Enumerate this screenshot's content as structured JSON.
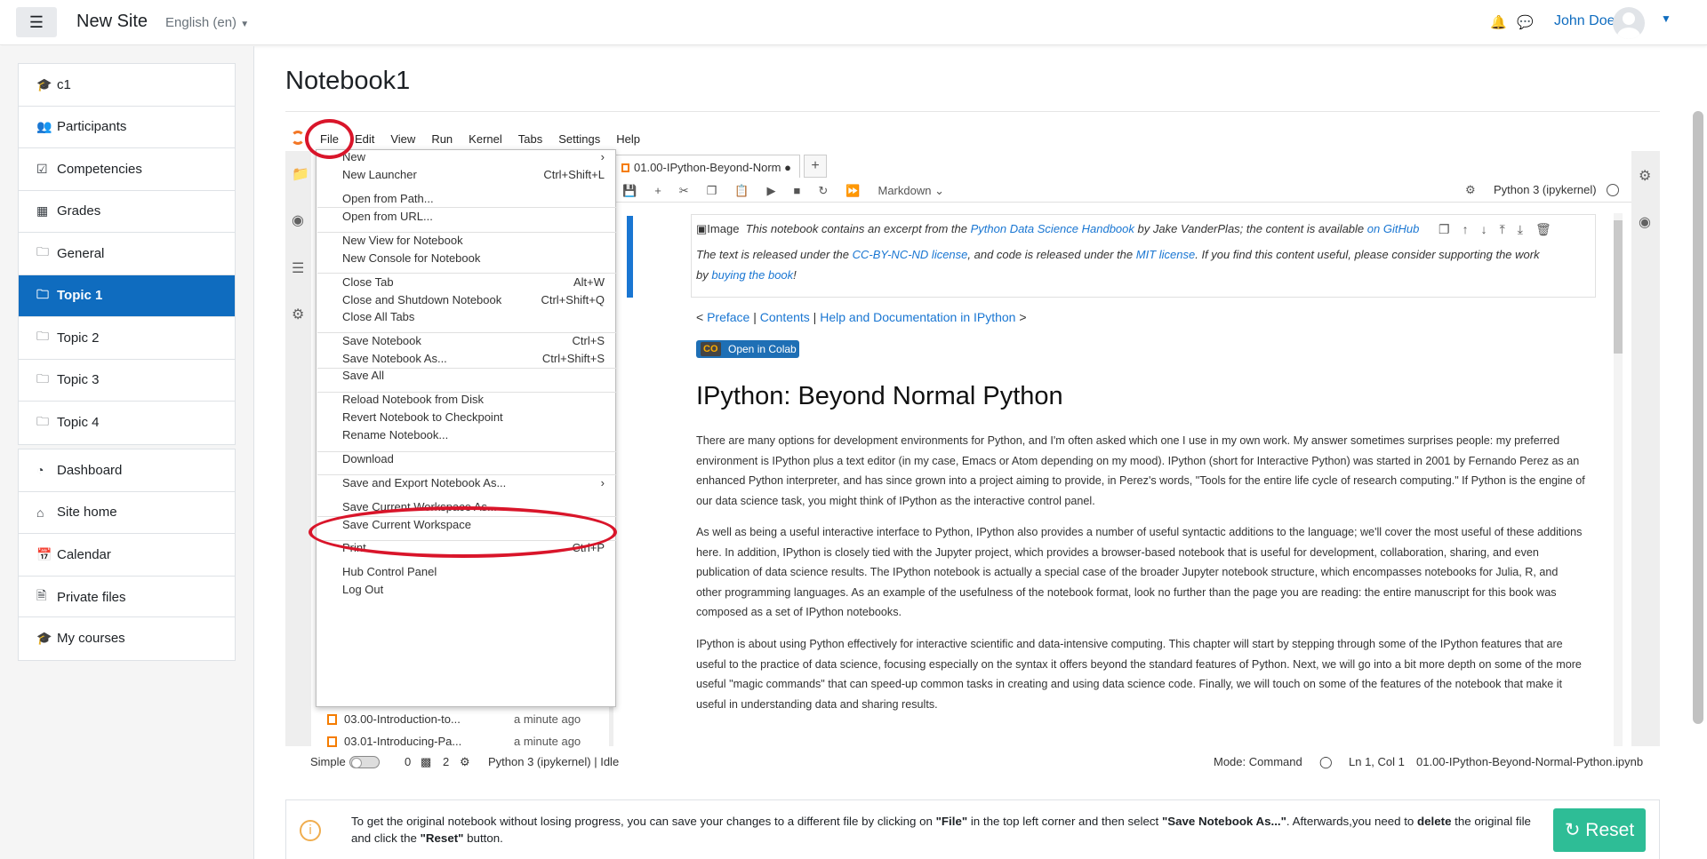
{
  "header": {
    "site_name": "New Site",
    "language": "English (en)",
    "user_name": "John Doe"
  },
  "nav": {
    "group1": [
      {
        "label": "c1",
        "icon": "graduation-cap-icon"
      },
      {
        "label": "Participants",
        "icon": "users-icon"
      },
      {
        "label": "Competencies",
        "icon": "check-square-icon"
      },
      {
        "label": "Grades",
        "icon": "table-icon"
      },
      {
        "label": "General",
        "icon": "folder-icon"
      },
      {
        "label": "Topic 1",
        "icon": "folder-icon",
        "active": true
      },
      {
        "label": "Topic 2",
        "icon": "folder-icon"
      },
      {
        "label": "Topic 3",
        "icon": "folder-icon"
      },
      {
        "label": "Topic 4",
        "icon": "folder-icon"
      }
    ],
    "group2": [
      {
        "label": "Dashboard",
        "icon": "dashboard-icon"
      },
      {
        "label": "Site home",
        "icon": "home-icon"
      },
      {
        "label": "Calendar",
        "icon": "calendar-icon"
      },
      {
        "label": "Private files",
        "icon": "file-icon"
      }
    ],
    "group3": [
      {
        "label": "My courses",
        "icon": "graduation-cap-icon"
      }
    ]
  },
  "page": {
    "title": "Notebook1"
  },
  "jupyter": {
    "menus": [
      "File",
      "Edit",
      "View",
      "Run",
      "Kernel",
      "Tabs",
      "Settings",
      "Help"
    ],
    "tab_title": "01.00-IPython-Beyond-Norm",
    "cell_type": "Markdown",
    "kernel": "Python 3 (ipykernel)",
    "files": [
      {
        "name": "03.00-Introduction-to...",
        "time": "a minute ago"
      },
      {
        "name": "03.01-Introducing-Pa...",
        "time": "a minute ago"
      }
    ],
    "file_menu": [
      {
        "label": "New",
        "shortcut": "",
        "submenu": true
      },
      {
        "label": "New Launcher",
        "shortcut": "Ctrl+Shift+L"
      },
      {
        "label": "Open from Path...",
        "shortcut": ""
      },
      {
        "label": "Open from URL...",
        "shortcut": ""
      },
      {
        "label": "New View for Notebook",
        "shortcut": ""
      },
      {
        "label": "New Console for Notebook",
        "shortcut": ""
      },
      {
        "label": "Close Tab",
        "shortcut": "Alt+W"
      },
      {
        "label": "Close and Shutdown Notebook",
        "shortcut": "Ctrl+Shift+Q"
      },
      {
        "label": "Close All Tabs",
        "shortcut": ""
      },
      {
        "label": "Save Notebook",
        "shortcut": "Ctrl+S"
      },
      {
        "label": "Save Notebook As...",
        "shortcut": "Ctrl+Shift+S"
      },
      {
        "label": "Save All",
        "shortcut": ""
      },
      {
        "label": "Reload Notebook from Disk",
        "shortcut": ""
      },
      {
        "label": "Revert Notebook to Checkpoint",
        "shortcut": ""
      },
      {
        "label": "Rename Notebook...",
        "shortcut": ""
      },
      {
        "label": "Download",
        "shortcut": ""
      },
      {
        "label": "Save and Export Notebook As...",
        "shortcut": "",
        "submenu": true
      },
      {
        "label": "Save Current Workspace As...",
        "shortcut": ""
      },
      {
        "label": "Save Current Workspace",
        "shortcut": ""
      },
      {
        "label": "Print...",
        "shortcut": "Ctrl+P"
      },
      {
        "label": "Hub Control Panel",
        "shortcut": ""
      },
      {
        "label": "Log Out",
        "shortcut": ""
      }
    ],
    "notebook": {
      "cell1_line1_a": "This notebook contains an excerpt from the",
      "cell1_link1": "Python Data Science Handbook",
      "cell1_line1_b": "by Jake VanderPlas; the content is available",
      "cell1_link2": "on GitHub",
      "cell1_line2_a": "The text is released under the",
      "cell1_link3": "CC-BY-NC-ND license",
      "cell1_line2_b": ", and code is released under the",
      "cell1_link4": "MIT license",
      "cell1_line2_c": ". If you find this content useful, please consider supporting the work",
      "cell1_line3_a": "by",
      "cell1_link5": "buying the book",
      "image_alt": "Image",
      "nav_prev": "<",
      "nav_preface": "Preface",
      "nav_contents": "Contents",
      "nav_next": "Help and Documentation in IPython",
      "nav_gt": ">",
      "colab": "Open in Colab",
      "heading": "IPython: Beyond Normal Python",
      "p1": "There are many options for development environments for Python, and I'm often asked which one I use in my own work. My answer sometimes surprises people: my preferred environment is IPython plus a text editor (in my case, Emacs or Atom depending on my mood). IPython (short for Interactive Python) was started in 2001 by Fernando Perez as an enhanced Python interpreter, and has since grown into a project aiming to provide, in Perez's words, \"Tools for the entire life cycle of research computing.\" If Python is the engine of our data science task, you might think of IPython as the interactive control panel.",
      "p2": "As well as being a useful interactive interface to Python, IPython also provides a number of useful syntactic additions to the language; we'll cover the most useful of these additions here. In addition, IPython is closely tied with the Jupyter project, which provides a browser-based notebook that is useful for development, collaboration, sharing, and even publication of data science results. The IPython notebook is actually a special case of the broader Jupyter notebook structure, which encompasses notebooks for Julia, R, and other programming languages. As an example of the usefulness of the notebook format, look no further than the page you are reading: the entire manuscript for this book was composed as a set of IPython notebooks.",
      "p3": "IPython is about using Python effectively for interactive scientific and data-intensive computing. This chapter will start by stepping through some of the IPython features that are useful to the practice of data science, focusing especially on the syntax it offers beyond the standard features of Python. Next, we will go into a bit more depth on some of the more useful \"magic commands\" that can speed-up common tasks in creating and using data science code. Finally, we will touch on some of the features of the notebook that make it useful in understanding data and sharing results."
    },
    "status": {
      "mode_label": "Simple",
      "count_a": "0",
      "count_b": "2",
      "kernel_state": "Python 3 (ipykernel) | Idle",
      "mode": "Mode: Command",
      "cursor": "Ln 1, Col 1",
      "filename": "01.00-IPython-Beyond-Normal-Python.ipynb"
    }
  },
  "alert": {
    "text_a": "To get the original notebook without losing progress, you can save your changes to a different file by clicking on",
    "text_b": "\"File\"",
    "text_c": "in the top left corner and then select",
    "text_d": "\"Save Notebook As...\"",
    "text_e": ". Afterwards,you need to",
    "text_f": "delete",
    "text_g": "the original file and click the",
    "text_h": "\"Reset\"",
    "text_i": "button.",
    "button": "Reset"
  }
}
